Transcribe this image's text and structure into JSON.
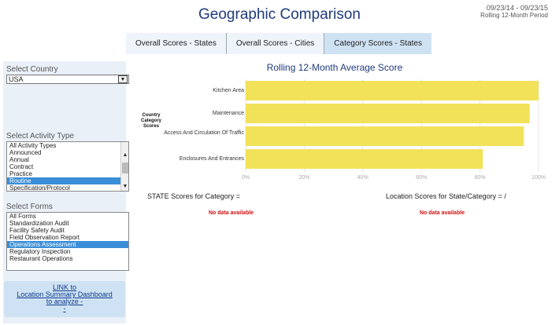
{
  "header": {
    "title": "Geographic Comparison",
    "date_range": "09/23/14 - 09/23/15",
    "period": "Rolling 12-Month Period"
  },
  "tabs": [
    {
      "label": "Overall Scores - States",
      "active": false
    },
    {
      "label": "Overall Scores - Cities",
      "active": false
    },
    {
      "label": "Category Scores - States",
      "active": true
    }
  ],
  "sidebar": {
    "country": {
      "label": "Select Country",
      "value": "USA"
    },
    "activity": {
      "label": "Select Activity Type",
      "items": [
        "All Activity Types",
        "Announced",
        "Annual",
        "Contract",
        "Practice",
        "Routine",
        "Specification/Protocol"
      ],
      "selected": "Routine"
    },
    "forms": {
      "label": "Select Forms",
      "items": [
        "All Forms",
        "Standardization Audit",
        "Facility Safety Audit",
        "Field Observation Report",
        "Operations Assessment",
        "Regulatory Inspection",
        "Restaurant Operations"
      ],
      "selected": "Operations Assessment"
    },
    "link": {
      "line1": "LINK to",
      "line2": "Location Summary Dashboard",
      "line3": "to analyze -",
      "line4": "-"
    }
  },
  "chart_data": {
    "type": "bar",
    "orientation": "horizontal",
    "title": "Rolling 12-Month Average Score",
    "ylabel": "Country Category Scores",
    "categories": [
      "Kitchen Area",
      "Maintenance",
      "Access And Circulation Of Traffic",
      "Enclosures And Entrances"
    ],
    "values": [
      100,
      97,
      95,
      81
    ],
    "x_ticks": [
      "0%",
      "20%",
      "40%",
      "60%",
      "80%",
      "100%"
    ],
    "xlim": [
      0,
      100
    ],
    "bar_color": "#f2e25a",
    "grid": true
  },
  "bottom": {
    "state_title": "STATE Scores for Category =",
    "state_nodata": "No data available",
    "location_title": "Location Scores for State/Category = /",
    "location_nodata": "No data available"
  }
}
